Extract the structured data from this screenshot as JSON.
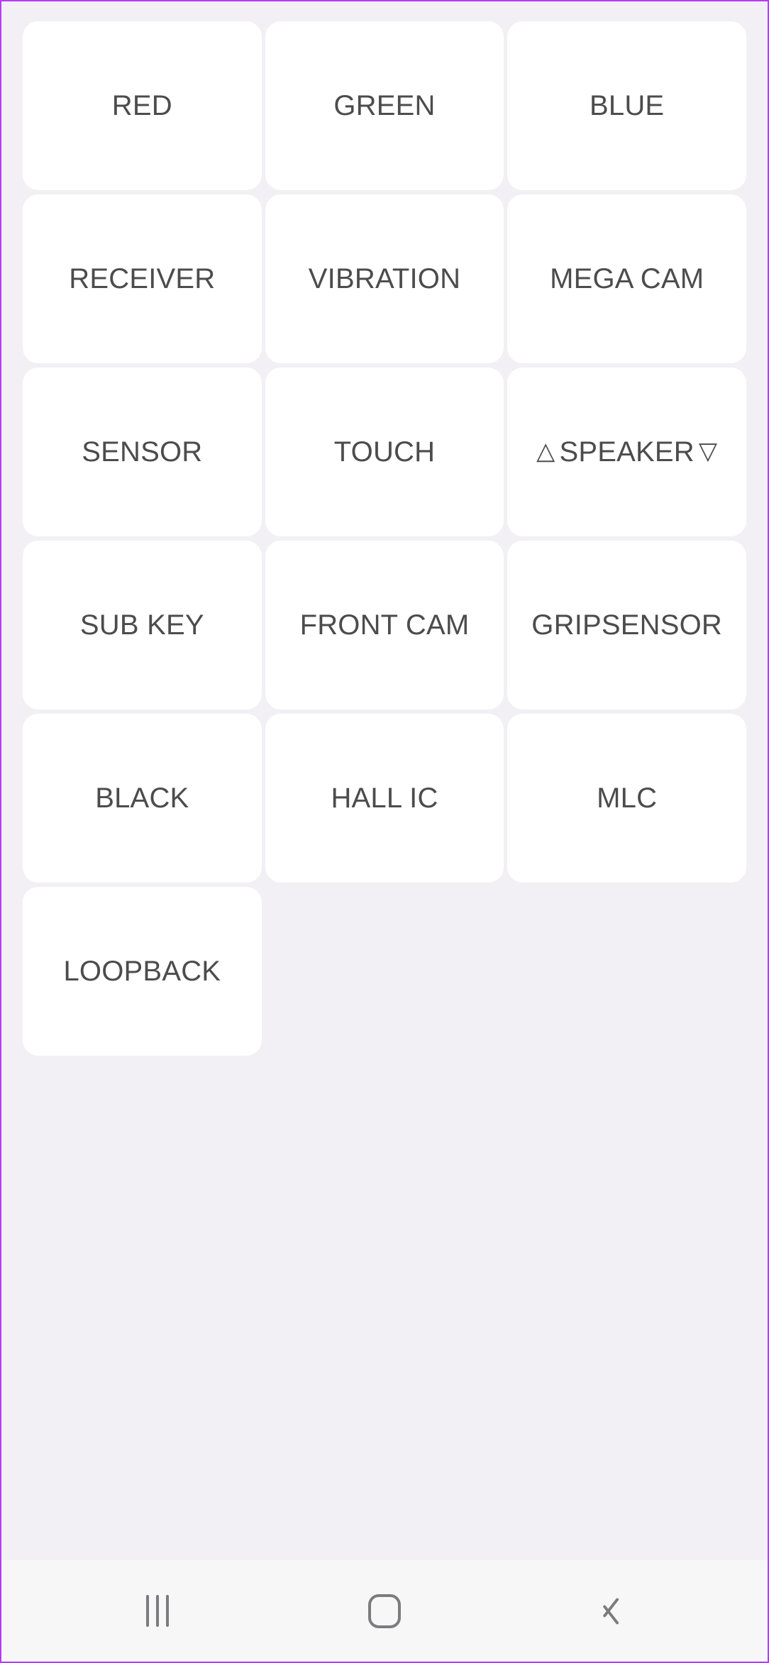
{
  "app": {
    "screen_name": "hardware-test-grid",
    "background_color": "#f2f0f4",
    "card_color": "#ffffff",
    "text_color": "#4c4c4c",
    "border_color": "#b43cfa",
    "navbar_color": "#f7f7f8",
    "nav_icon_color": "#7c7c80"
  },
  "grid": {
    "columns": 3,
    "rows": 6,
    "items": [
      {
        "label": "RED",
        "name": "test-button-red"
      },
      {
        "label": "GREEN",
        "name": "test-button-green"
      },
      {
        "label": "BLUE",
        "name": "test-button-blue"
      },
      {
        "label": "RECEIVER",
        "name": "test-button-receiver"
      },
      {
        "label": "VIBRATION",
        "name": "test-button-vibration"
      },
      {
        "label": "MEGA CAM",
        "name": "test-button-mega-cam"
      },
      {
        "label": "SENSOR",
        "name": "test-button-sensor"
      },
      {
        "label": "TOUCH",
        "name": "test-button-touch"
      },
      {
        "label": "SPEAKER",
        "name": "test-button-speaker",
        "prefix_icon": "triangle-up-outline",
        "prefix_glyph": "△",
        "suffix_icon": "triangle-down-outline",
        "suffix_glyph": "▽"
      },
      {
        "label": "SUB KEY",
        "name": "test-button-sub-key"
      },
      {
        "label": "FRONT CAM",
        "name": "test-button-front-cam"
      },
      {
        "label": "GRIPSENSOR",
        "name": "test-button-gripsensor"
      },
      {
        "label": "BLACK",
        "name": "test-button-black"
      },
      {
        "label": "HALL IC",
        "name": "test-button-hall-ic"
      },
      {
        "label": "MLC",
        "name": "test-button-mlc"
      },
      {
        "label": "LOOPBACK",
        "name": "test-button-loopback"
      }
    ]
  },
  "navbar": {
    "buttons": [
      {
        "icon": "recents-icon",
        "name": "nav-recents-button"
      },
      {
        "icon": "home-icon",
        "name": "nav-home-button"
      },
      {
        "icon": "back-icon",
        "name": "nav-back-button"
      }
    ]
  }
}
